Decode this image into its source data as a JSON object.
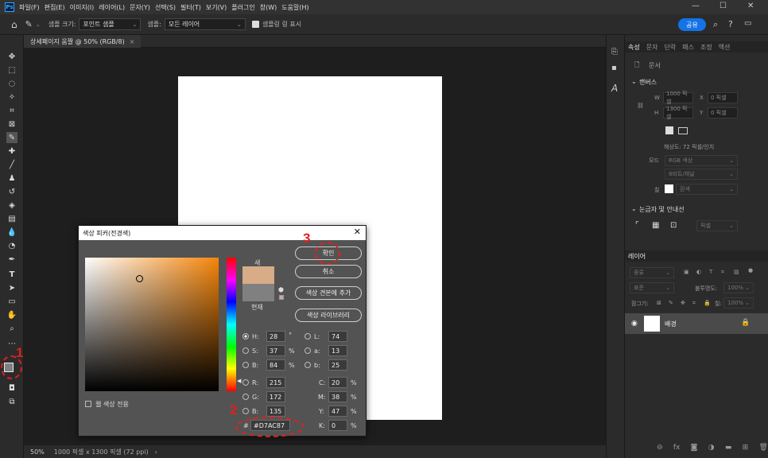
{
  "menubar": {
    "logo": "Ps",
    "items": [
      "파일(F)",
      "편집(E)",
      "이미지(I)",
      "레이어(L)",
      "문자(Y)",
      "선택(S)",
      "필터(T)",
      "보기(V)",
      "플러그인",
      "창(W)",
      "도움말(H)"
    ],
    "minimize": "—",
    "maximize": "☐",
    "close": "✕"
  },
  "options": {
    "sample_size_label": "샘플 크기:",
    "sample_size_value": "포인트 샘플",
    "sample_label": "샘플:",
    "sample_value": "모든 레이어",
    "show_ring_label": "샘플링 링 표시",
    "share": "공유"
  },
  "document": {
    "tab_title": "상세페이지 움짤 @ 50% (RGB/8)",
    "tab_close": "×",
    "zoom": "50%",
    "info": "1000 픽셀 x 1300 픽셀 (72 ppi)"
  },
  "properties": {
    "tabs": [
      "속성",
      "문자",
      "단락",
      "패스",
      "조정",
      "액션"
    ],
    "doc_label": "문서",
    "canvas_section": "캔버스",
    "w_label": "W",
    "w_value": "1000 픽셀",
    "x_label": "X",
    "x_value": "0 픽셀",
    "h_label": "H",
    "h_value": "1300 픽셀",
    "y_label": "Y",
    "y_value": "0 픽셀",
    "resolution": "해상도: 72 픽셀/인치",
    "mode_label": "모드",
    "mode_value": "RGB 색상",
    "bit_value": "8비트/채널",
    "fill_label": "칠",
    "fill_value": "흰색",
    "rulers_section": "눈금자 및 안내선",
    "units_value": "픽셀"
  },
  "layers": {
    "tab": "레이어",
    "filter_value": "종류",
    "blend_value": "표준",
    "opacity_label": "불투명도:",
    "opacity_value": "100%",
    "lock_label": "잠그기:",
    "fill_label": "칠:",
    "fill_value": "100%",
    "layer_name": "배경"
  },
  "picker": {
    "title": "색상 피커(전경색)",
    "ok": "확인",
    "cancel": "취소",
    "add_swatch": "색상 견본에 추가",
    "libraries": "색상 라이브러리",
    "new_label": "새",
    "current_label": "현재",
    "new_color": "#d7ac87",
    "current_color": "#808080",
    "web_only": "웹 색상 전용",
    "H": "28",
    "S": "37",
    "B": "84",
    "R": "215",
    "G": "172",
    "Bv": "135",
    "L": "74",
    "a": "13",
    "b": "25",
    "C": "20",
    "M": "38",
    "Y": "47",
    "K": "0",
    "hex": "#D7AC87"
  },
  "annotations": {
    "one": "1",
    "two": "2",
    "three": "3"
  }
}
